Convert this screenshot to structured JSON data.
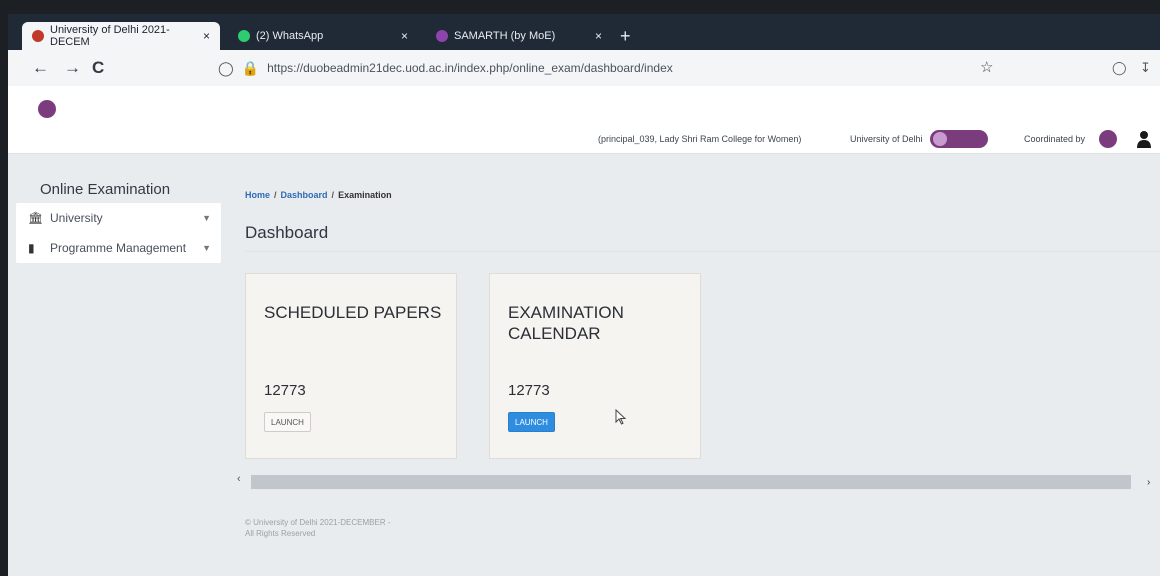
{
  "browser": {
    "tabs": [
      {
        "label": "University of Delhi 2021-DECEM",
        "close": "×",
        "favicon_color": "#c0392b"
      },
      {
        "label": "(2) WhatsApp",
        "close": "×",
        "favicon_color": "#2ecc71"
      },
      {
        "label": "SAMARTH (by MoE)",
        "close": "×",
        "favicon_color": "#8e44ad"
      }
    ],
    "new_tab": "+",
    "back": "←",
    "forward": "→",
    "reload": "C",
    "url": "https://duobeadmin21dec.uod.ac.in/index.php/online_exam/dashboard/index"
  },
  "header": {
    "user_info": "(principal_039, Lady Shri Ram College for Women)",
    "university": "University of Delhi",
    "coordinated_by": "Coordinated by"
  },
  "sidebar": {
    "title": "Online Examination",
    "items": [
      {
        "label": "University",
        "icon": "university-icon"
      },
      {
        "label": "Programme Management",
        "icon": "book-icon"
      }
    ]
  },
  "main": {
    "breadcrumb": [
      "Home",
      "Dashboard",
      "Examination"
    ],
    "title": "Dashboard",
    "cards": [
      {
        "title": "SCHEDULED PAPERS",
        "count": "12773",
        "button": "LAUNCH"
      },
      {
        "title": "EXAMINATION CALENDAR",
        "count": "12773",
        "button": "LAUNCH"
      }
    ],
    "footer_line1": "© University of Delhi 2021-DECEMBER -",
    "footer_line2": "All Rights Reserved"
  },
  "colors": {
    "brand_purple": "#7b3c7d",
    "link_blue": "#2e6bb5",
    "primary_button": "#2e8de0"
  }
}
